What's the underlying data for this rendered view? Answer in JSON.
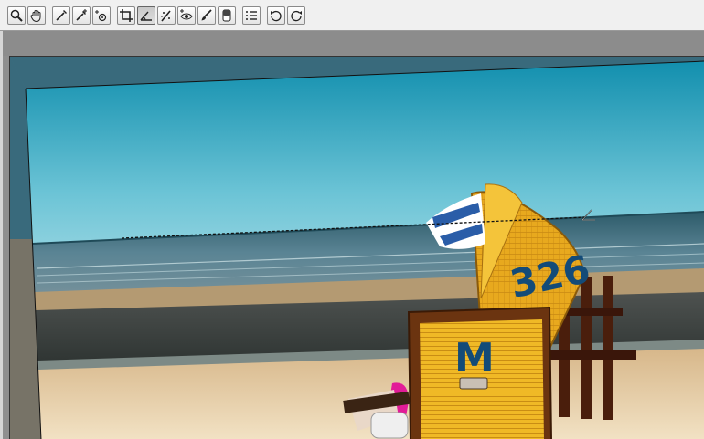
{
  "toolbar": {
    "tools": [
      {
        "name": "zoom-tool",
        "icon": "magnifier-icon",
        "active": false
      },
      {
        "name": "hand-tool",
        "icon": "hand-icon",
        "active": false
      },
      {
        "name": "white-balance-tool",
        "icon": "eyedropper-icon",
        "active": false
      },
      {
        "name": "color-sampler-tool",
        "icon": "eyedropper-plus-icon",
        "active": false
      },
      {
        "name": "targeted-adjustment-tool",
        "icon": "target-adjust-icon",
        "active": false
      },
      {
        "name": "crop-tool",
        "icon": "crop-icon",
        "active": false
      },
      {
        "name": "straighten-tool",
        "icon": "straighten-icon",
        "active": true
      },
      {
        "name": "spot-removal-tool",
        "icon": "spot-removal-icon",
        "active": false
      },
      {
        "name": "red-eye-tool",
        "icon": "red-eye-icon",
        "active": false
      },
      {
        "name": "adjustment-brush-tool",
        "icon": "brush-icon",
        "active": false
      },
      {
        "name": "graduated-filter-tool",
        "icon": "graduated-filter-icon",
        "active": false
      },
      {
        "name": "preferences-tool",
        "icon": "list-icon",
        "active": false
      },
      {
        "name": "rotate-left-tool",
        "icon": "rotate-ccw-icon",
        "active": false
      },
      {
        "name": "rotate-right-tool",
        "icon": "rotate-cw-icon",
        "active": false
      }
    ]
  },
  "beach_chair": {
    "number": "326",
    "letter": "M"
  },
  "colors": {
    "toolbar_bg": "#f0f0f0",
    "workspace_bg": "#8c8c8c",
    "sky_top": "#1b9bb8",
    "sky_bottom": "#d8eef0",
    "chair_yellow": "#e8a91e",
    "chair_wood": "#6b3410"
  }
}
